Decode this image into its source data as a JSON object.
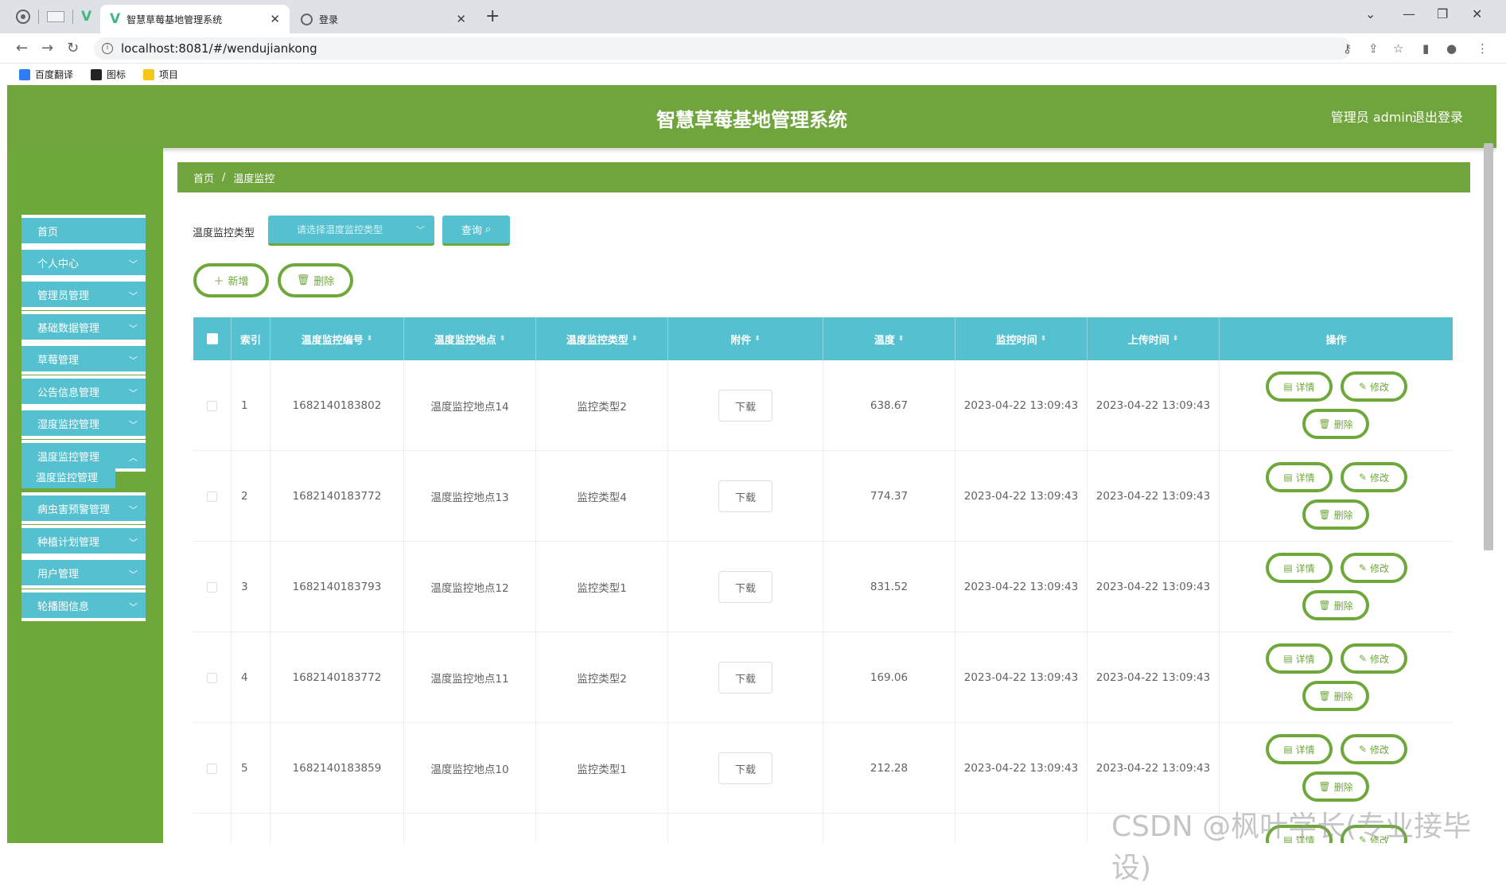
{
  "browser": {
    "tabs": [
      {
        "title": "智慧草莓基地管理系统",
        "active": true
      },
      {
        "title": "登录",
        "active": false
      }
    ],
    "close_glyph": "✕",
    "new_tab_glyph": "+",
    "url": "localhost:8081/#/wendujiankong",
    "bookmarks": [
      "百度翻译",
      "图标",
      "项目"
    ]
  },
  "header": {
    "title": "智慧草莓基地管理系统",
    "user": "管理员 admin",
    "logout": "退出登录"
  },
  "sidebar": {
    "items": [
      {
        "label": "首页",
        "has_chevron": false
      },
      {
        "label": "个人中心",
        "has_chevron": true
      },
      {
        "label": "管理员管理",
        "has_chevron": true
      },
      {
        "label": "基础数据管理",
        "has_chevron": true
      },
      {
        "label": "草莓管理",
        "has_chevron": true
      },
      {
        "label": "公告信息管理",
        "has_chevron": true
      },
      {
        "label": "湿度监控管理",
        "has_chevron": true
      },
      {
        "label": "温度监控管理",
        "has_chevron": true,
        "expanded": true
      },
      {
        "label": "病虫害预警管理",
        "has_chevron": true
      },
      {
        "label": "种植计划管理",
        "has_chevron": true
      },
      {
        "label": "用户管理",
        "has_chevron": true
      },
      {
        "label": "轮播图信息",
        "has_chevron": true
      }
    ],
    "submenu": {
      "label": "温度监控管理"
    }
  },
  "breadcrumb": {
    "home": "首页",
    "sep": "/",
    "current": "温度监控"
  },
  "search": {
    "label": "温度监控类型",
    "placeholder": "请选择温度监控类型",
    "button": "查询"
  },
  "actions": {
    "add": "新增",
    "delete": "删除"
  },
  "table": {
    "columns": [
      "索引",
      "温度监控编号",
      "温度监控地点",
      "温度监控类型",
      "附件",
      "温度",
      "监控时间",
      "上传时间",
      "操作"
    ],
    "rows": [
      {
        "index": "1",
        "code": "1682140183802",
        "location": "温度监控地点14",
        "type": "监控类型2",
        "attach": "下载",
        "temp": "638.67",
        "monitor_time": "2023-04-22 13:09:43",
        "upload_time": "2023-04-22 13:09:43"
      },
      {
        "index": "2",
        "code": "1682140183772",
        "location": "温度监控地点13",
        "type": "监控类型4",
        "attach": "下载",
        "temp": "774.37",
        "monitor_time": "2023-04-22 13:09:43",
        "upload_time": "2023-04-22 13:09:43"
      },
      {
        "index": "3",
        "code": "1682140183793",
        "location": "温度监控地点12",
        "type": "监控类型1",
        "attach": "下载",
        "temp": "831.52",
        "monitor_time": "2023-04-22 13:09:43",
        "upload_time": "2023-04-22 13:09:43"
      },
      {
        "index": "4",
        "code": "1682140183772",
        "location": "温度监控地点11",
        "type": "监控类型2",
        "attach": "下载",
        "temp": "169.06",
        "monitor_time": "2023-04-22 13:09:43",
        "upload_time": "2023-04-22 13:09:43"
      },
      {
        "index": "5",
        "code": "1682140183859",
        "location": "温度监控地点10",
        "type": "监控类型1",
        "attach": "下载",
        "temp": "212.28",
        "monitor_time": "2023-04-22 13:09:43",
        "upload_time": "2023-04-22 13:09:43"
      }
    ],
    "row_actions": {
      "detail": "详情",
      "edit": "修改",
      "delete": "删除"
    }
  },
  "watermark": "CSDN @枫叶学长(专业接毕设)",
  "colors": {
    "green": "#70a43d",
    "cyan": "#55c0d0"
  }
}
